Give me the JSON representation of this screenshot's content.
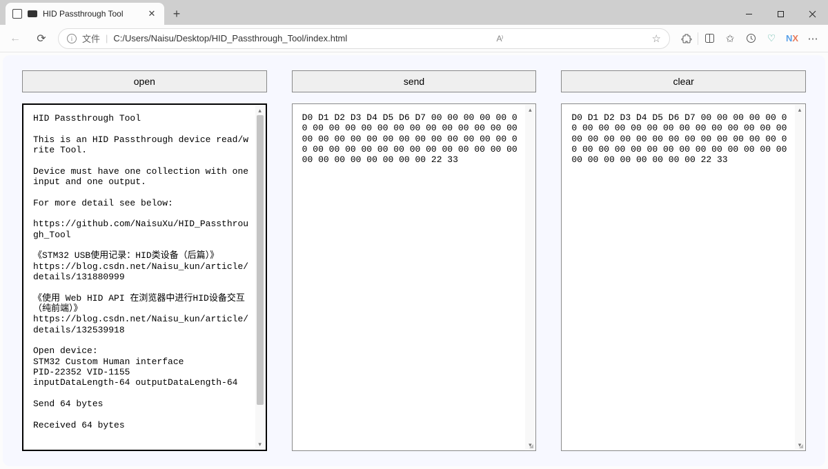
{
  "browser": {
    "tab_title": "HID Passthrough Tool",
    "url_label": "文件",
    "url": "C:/Users/Naisu/Desktop/HID_Passthrough_Tool/index.html"
  },
  "buttons": {
    "open": "open",
    "send": "send",
    "clear": "clear"
  },
  "left_panel": "HID Passthrough Tool\n\nThis is an HID Passthrough device read/write Tool.\n\nDevice must have one collection with one input and one output.\n\nFor more detail see below:\n\nhttps://github.com/NaisuXu/HID_Passthrough_Tool\n\n《STM32 USB使用记录：HID类设备（后篇）》\nhttps://blog.csdn.net/Naisu_kun/article/details/131880999\n\n《使用 Web HID API 在浏览器中进行HID设备交互（纯前端）》\nhttps://blog.csdn.net/Naisu_kun/article/details/132539918\n\nOpen device:\nSTM32 Custom Human interface\nPID-22352 VID-1155\ninputDataLength-64 outputDataLength-64\n\nSend 64 bytes\n\nReceived 64 bytes",
  "mid_panel": "D0 D1 D2 D3 D4 D5 D6 D7 00 00 00 00 00 00 00 00 00 00 00 00 00 00 00 00 00 00 00 00 00 00 00 00 00 00 00 00 00 00 00 00 00 00 00 00 00 00 00 00 00 00 00 00 00 00 00 00 00 00 00 00 00 00 22 33",
  "right_panel": "D0 D1 D2 D3 D4 D5 D6 D7 00 00 00 00 00 00 00 00 00 00 00 00 00 00 00 00 00 00 00 00 00 00 00 00 00 00 00 00 00 00 00 00 00 00 00 00 00 00 00 00 00 00 00 00 00 00 00 00 00 00 00 00 00 00 22 33"
}
